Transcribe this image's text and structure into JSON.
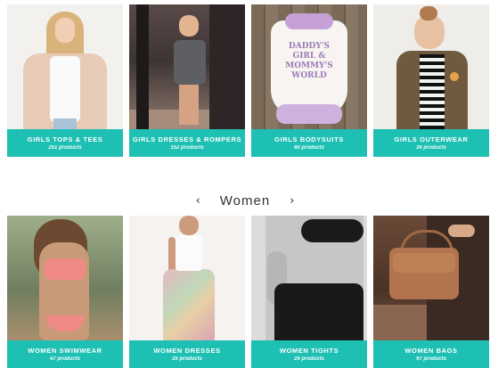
{
  "girls_categories": [
    {
      "name": "GIRLS TOPS & TEES",
      "count": "251 products"
    },
    {
      "name": "GIRLS DRESSES & ROMPERS",
      "count": "152 products"
    },
    {
      "name": "GIRLS BODYSUITS",
      "count": "80 products"
    },
    {
      "name": "GIRLS OUTERWEAR",
      "count": "36 products"
    }
  ],
  "section": {
    "title": "Women",
    "prev_icon": "‹",
    "next_icon": "›"
  },
  "women_categories": [
    {
      "name": "WOMEN SWIMWEAR",
      "count": "47 products"
    },
    {
      "name": "WOMEN DRESSES",
      "count": "35 products"
    },
    {
      "name": "WOMEN TIGHTS",
      "count": "26 products"
    },
    {
      "name": "WOMEN BAGS",
      "count": "97 products"
    }
  ],
  "bodysuit_print": "DADDY'S GIRL & MOMMY'S WORLD",
  "colors": {
    "accent": "#1ec0b4",
    "label_text": "#ffffff"
  }
}
